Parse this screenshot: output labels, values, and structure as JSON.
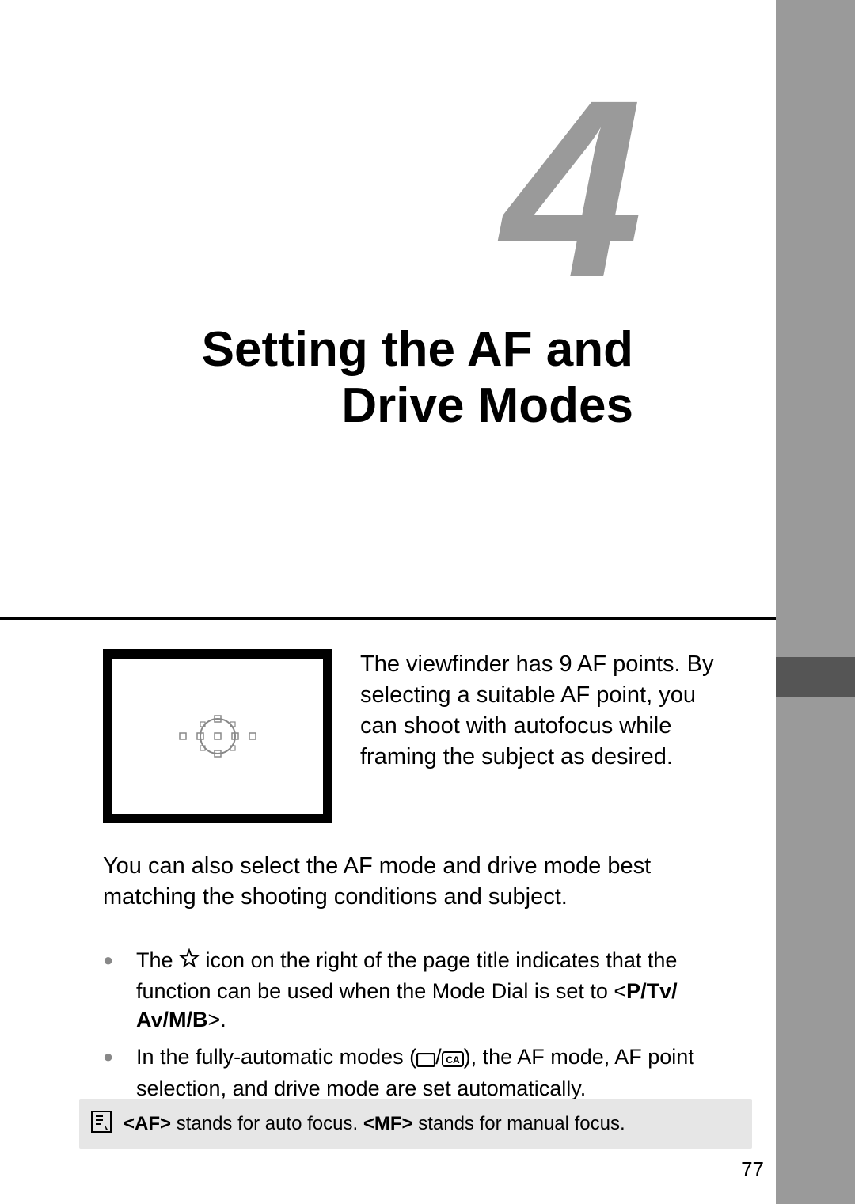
{
  "chapter": {
    "number": "4",
    "title_line1": "Setting the AF and",
    "title_line2": "Drive Modes"
  },
  "intro": {
    "p1": "The viewfinder has 9 AF points. By selecting a suitable AF point, you can shoot with autofocus while framing the subject as desired.",
    "p2": "You can also select the AF mode and drive mode best matching the shooting conditions and subject."
  },
  "bullets": {
    "b1_part1": "The ",
    "b1_part2": " icon on the right of the page title indicates that the function can be used when the Mode Dial is set to <",
    "b1_modes": "P/Tv/ Av/M/B",
    "b1_part3": ">.",
    "b2_part1": "In the fully-automatic modes (",
    "b2_part2": "), the AF mode, AF point selection, and drive mode are set automatically."
  },
  "footnote": {
    "af": "<AF>",
    "af_text": " stands for auto focus. ",
    "mf": "<MF>",
    "mf_text": " stands for manual focus."
  },
  "page_number": "77",
  "icons": {
    "star": "star-icon",
    "full_auto_rect": "full-auto-rect-icon",
    "creative_auto": "creative-auto-icon",
    "note": "note-icon"
  }
}
